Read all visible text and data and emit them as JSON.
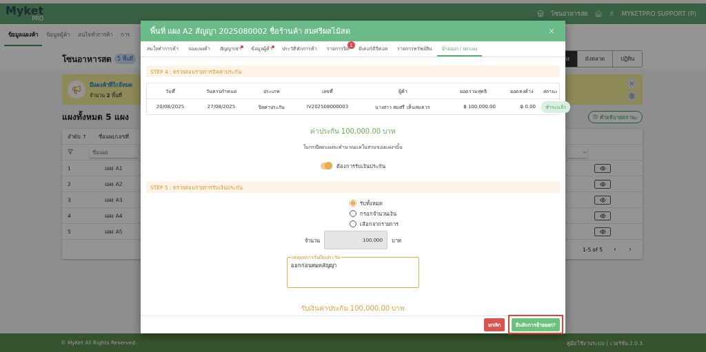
{
  "header": {
    "logo": "Myket",
    "logo_sub": "PRO",
    "zone": "โซนอาหารสด",
    "user": "MYKETPRO SUPPORT (P)"
  },
  "nav_tabs": [
    {
      "label": "ข้อมูลแผงค้า",
      "selected": true
    },
    {
      "label": "ข้อมูลผู้ค้า",
      "selected": false
    },
    {
      "label": "สนใจทำการค้า",
      "selected": false
    },
    {
      "label": "การ",
      "selected": false
    }
  ],
  "page": {
    "title": "โซนอาหารสด",
    "badge": "5 พื้นที่",
    "views": [
      {
        "label": "าง",
        "selected": true
      },
      {
        "label": "ผังตลาด",
        "selected": false
      },
      {
        "label": "ปฏิทิน",
        "selected": false
      }
    ],
    "alert": {
      "title": "มีแผงค้าที่ใกล้หมด",
      "text": "จำนวน **2** พื้นที่"
    },
    "heading": "แผงทั้งหมด 5 แผง",
    "status_help": "คำอธิบายสถานะ",
    "table": {
      "columns": [
        "ลำดับ ↑",
        "ชื่อแผง/เลขที่"
      ],
      "filter_placeholder": "ชื่อแผง",
      "rows": [
        {
          "index": "1",
          "name": "แผง A1"
        },
        {
          "index": "2",
          "name": "แผง A2"
        },
        {
          "index": "3",
          "name": "แผง A3"
        },
        {
          "index": "4",
          "name": "แผง A4"
        },
        {
          "index": "5",
          "name": "แผง A5"
        }
      ],
      "pagination": "1-5 of 5"
    }
  },
  "footer": {
    "copyright": "© MyKet All Rights Reserved.",
    "links": "คู่มือใช้งานระบบ | เวอร์ชั่น 2.0.3"
  },
  "modal": {
    "title": "พื้นที่ แผง A2 สัญญา 2025080002 ชื่อร้านค้า สมศรีผลไม้สด",
    "tabs": [
      {
        "label": "สนใจทำการค้า",
        "selected": false,
        "dot": false
      },
      {
        "label": "จองแผงค้า",
        "selected": false,
        "dot": false
      },
      {
        "label": "สัญญาเช่า",
        "selected": false,
        "dot": true
      },
      {
        "label": "ข้อมูลผู้ค้า",
        "selected": false,
        "dot": true
      },
      {
        "label": "ประวัติพักการค้า",
        "selected": false,
        "dot": false
      },
      {
        "label": "รายการบิล",
        "selected": false,
        "dot": false,
        "badge": "1"
      },
      {
        "label": "มิเตอร์ดิจิตอล",
        "selected": false,
        "dot": false
      },
      {
        "label": "รายการทรัพย์สิน",
        "selected": false,
        "dot": false
      },
      {
        "label": "ย้ายออก / ลดแผง",
        "selected": true,
        "dot": false
      }
    ],
    "step4": "STEP 4 : ตรวจสอบรายการบิลค่าประกัน",
    "bill_table": {
      "columns": [
        "วันที่",
        "วันครบกำหนด",
        "ประเภท",
        "เลขที่",
        "ผู้ค้า",
        "ยอดรวมสุทธิ",
        "ยอดคงค้าง",
        "สถานะ"
      ],
      "rows": [
        {
          "cells": [
            "20/08/2025",
            "27/08/2025",
            "บิลค่าประกัน",
            "IV202508000003",
            "นางสาว สมศรี เห็นสมควร",
            "฿ 100,000.00",
            "฿ 0.00"
          ],
          "status": "ชำระแล้ว"
        }
      ]
    },
    "deposit": "ค่าประกัน 100,000.00 บาท",
    "note": "ในกรณีลดแผงจะคำนวณแค่ในส่วนของแผงฯนั้น",
    "deposit_toggle": {
      "label": "ต้องการรับเงินประกัน",
      "on": true
    },
    "step5": "STEP 5 : ตรวจสอบรายการรับเงินประกัน",
    "options": [
      {
        "label": "รับทั้งหมด",
        "selected": true
      },
      {
        "label": "กรอกจำนวนเงิน",
        "selected": false
      },
      {
        "label": "เลือกจากรายการ",
        "selected": false
      }
    ],
    "amount": {
      "label": "จำนวน",
      "value": "100,000",
      "unit": "บาท",
      "disabled": true
    },
    "reason": {
      "label": "เหตุผลการรับเงินประกัน",
      "value": "ออกก่อนหมดสัญญา"
    },
    "total": "รับเงินค่าประกัน 100,000.00 บาท",
    "buttons": [
      {
        "kind": "cancel",
        "label": "ยกเลิก",
        "highlighted": false
      },
      {
        "kind": "confirm",
        "label": "ยืนยันการย้ายออก?",
        "highlighted": true
      }
    ]
  }
}
